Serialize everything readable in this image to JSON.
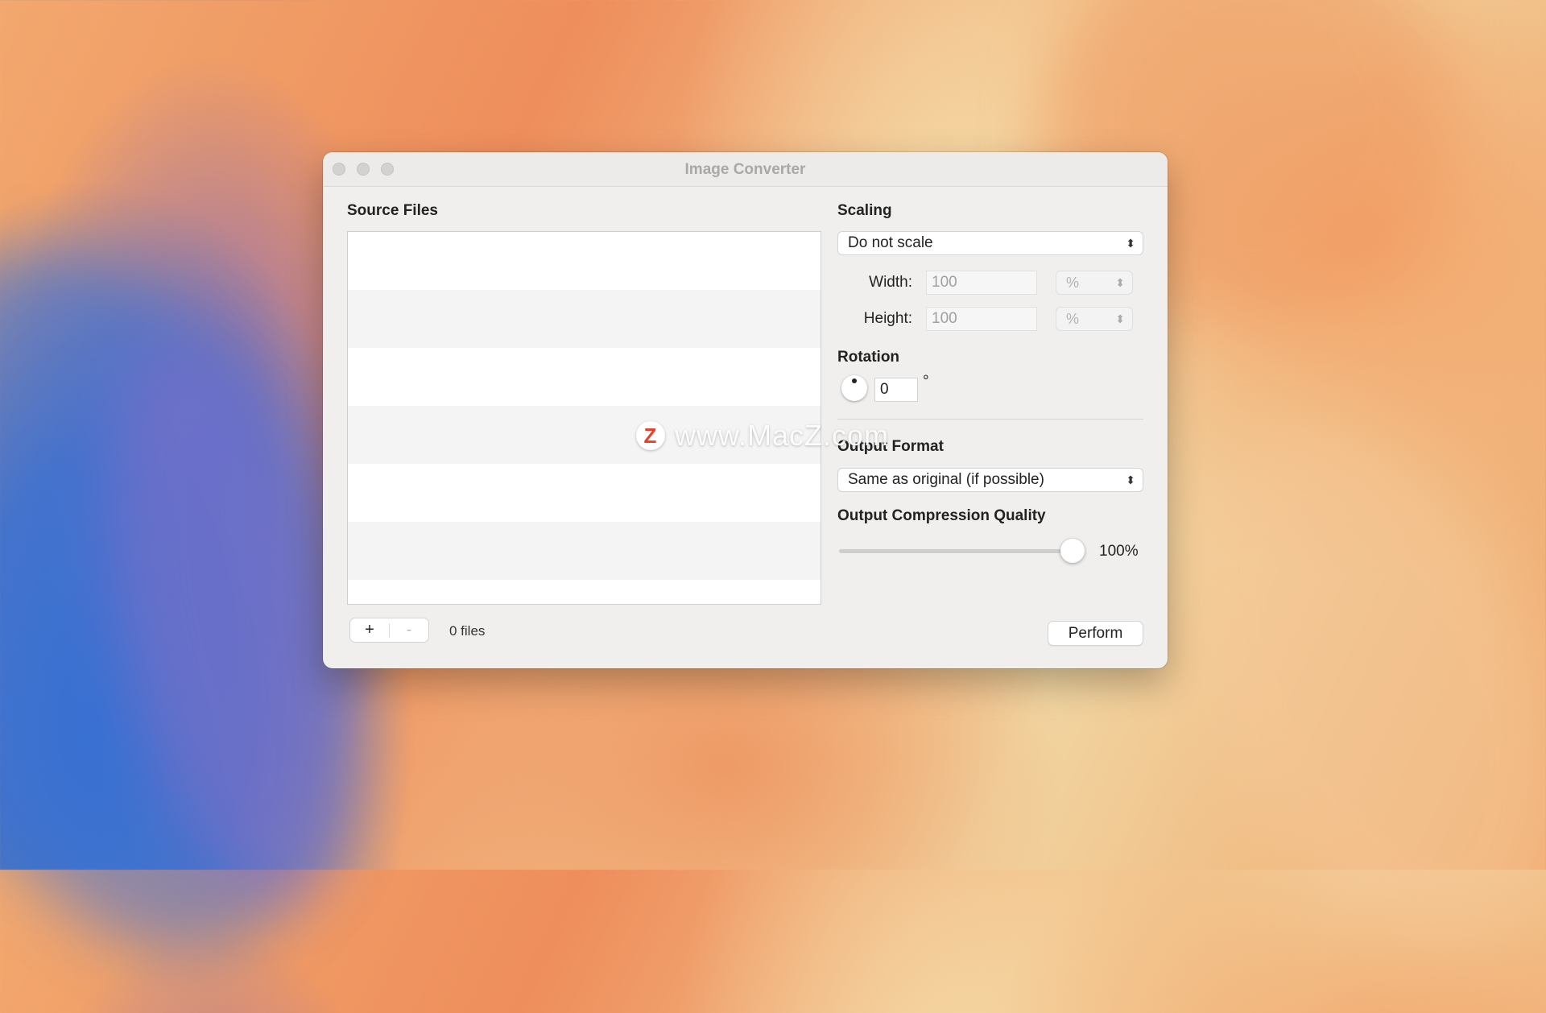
{
  "window": {
    "title": "Image Converter"
  },
  "source": {
    "title": "Source Files",
    "add_label": "+",
    "remove_label": "-",
    "count_text": "0 files"
  },
  "scaling": {
    "title": "Scaling",
    "mode": "Do not scale",
    "width_label": "Width:",
    "width_value": "100",
    "width_unit": "%",
    "height_label": "Height:",
    "height_value": "100",
    "height_unit": "%"
  },
  "rotation": {
    "title": "Rotation",
    "value": "0",
    "unit": "°"
  },
  "output": {
    "format_title": "Output Format",
    "format_value": "Same as original (if possible)",
    "quality_title": "Output Compression Quality",
    "quality_percent": 100,
    "quality_text": "100%"
  },
  "actions": {
    "perform_label": "Perform"
  },
  "watermark": {
    "logo_letter": "Z",
    "text": "www.MacZ.com"
  },
  "icons": {
    "popup": "chevron-updown-icon",
    "dial": "rotation-dial-icon"
  },
  "colors": {
    "window_bg": "#f0efee",
    "watermark_logo": "#e8412b"
  }
}
